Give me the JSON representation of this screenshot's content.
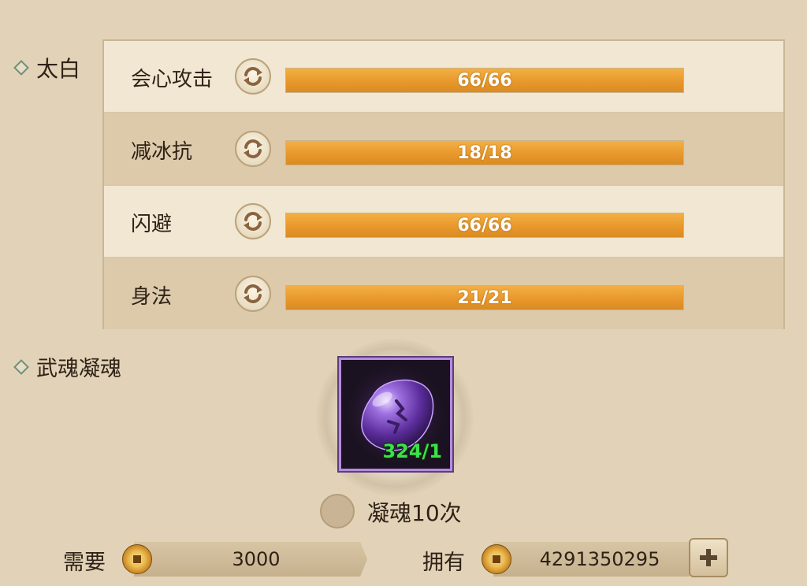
{
  "attributes": {
    "title": "太白",
    "rows": [
      {
        "label": "会心攻击",
        "value_text": "66/66",
        "current": 66,
        "max": 66
      },
      {
        "label": "减冰抗",
        "value_text": "18/18",
        "current": 18,
        "max": 18
      },
      {
        "label": "闪避",
        "value_text": "66/66",
        "current": 66,
        "max": 66
      },
      {
        "label": "身法",
        "value_text": "21/21",
        "current": 21,
        "max": 21
      }
    ]
  },
  "soul": {
    "title": "武魂凝魂",
    "item_count": "324/1",
    "option_label": "凝魂10次",
    "option_checked": false
  },
  "resources": {
    "need_label": "需要",
    "need_value": "3000",
    "have_label": "拥有",
    "have_value": "4291350295"
  },
  "icons": {
    "refresh": "refresh-cycle-icon",
    "coin": "copper-coin-icon",
    "plus": "plus-icon",
    "item": "purple-soul-stone-icon"
  },
  "colors": {
    "bar_fill": "#e7962a",
    "item_count": "#3ee04a",
    "item_border": "#b78ae0"
  }
}
